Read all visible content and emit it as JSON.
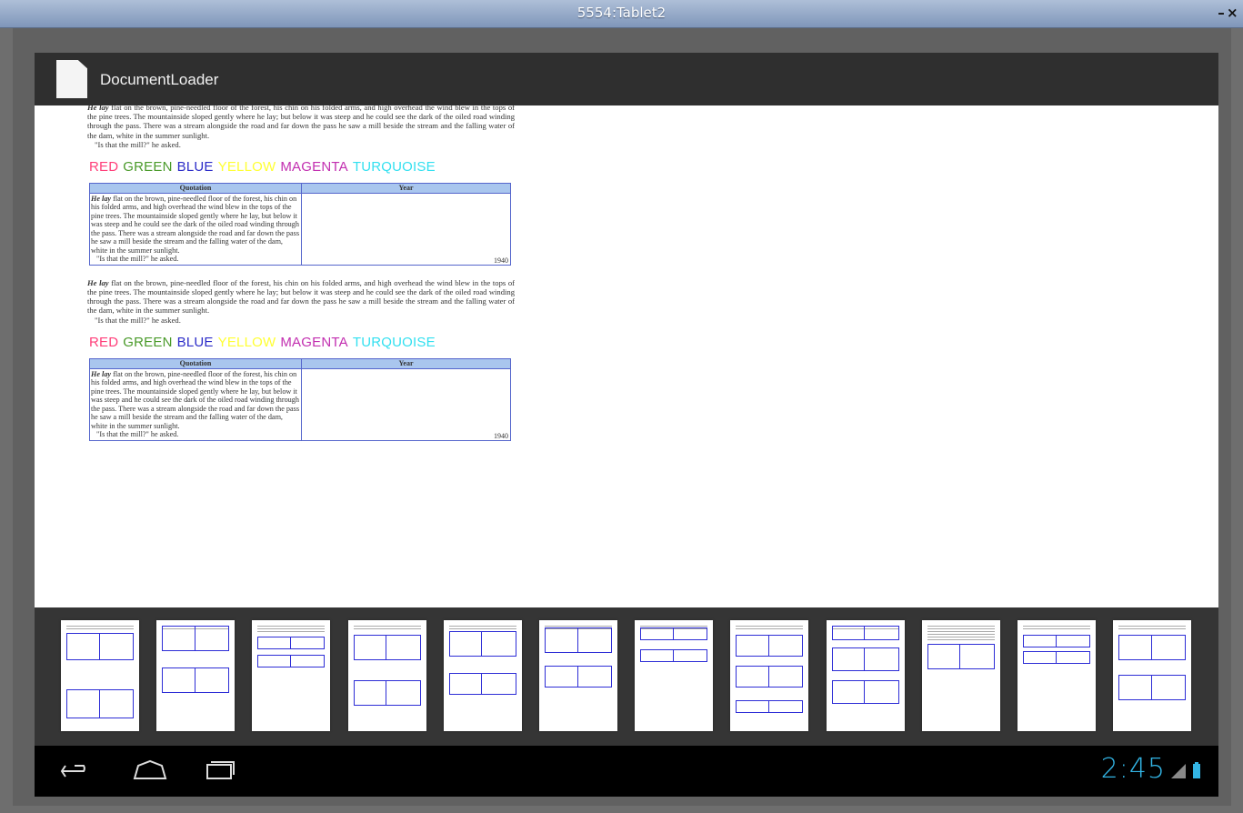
{
  "window": {
    "title": "5554:Tablet2",
    "minimize_label": "–",
    "close_label": "×"
  },
  "app": {
    "title": "DocumentLoader"
  },
  "document": {
    "paragraph_lead": "He lay",
    "paragraph_text": "flat on the brown, pine-needled floor of the forest, his chin on his folded arms, and high overhead the wind blew in the tops of the pine trees. The mountainside sloped gently where he lay; but below it was steep and he could see the dark of the oiled road winding through the pass. There was a stream alongside the road and far down the pass he saw a mill beside the stream and the falling water of the dam, white in the summer sunlight.",
    "quote_line": "\"Is that the mill?\" he asked.",
    "color_words": [
      {
        "text": "RED",
        "color": "#ff3f7a"
      },
      {
        "text": "GREEN",
        "color": "#4a9a2a"
      },
      {
        "text": "BLUE",
        "color": "#2c2cc8"
      },
      {
        "text": "YELLOW",
        "color": "#ffff33"
      },
      {
        "text": "MAGENTA",
        "color": "#c22fb0"
      },
      {
        "text": "TURQUOISE",
        "color": "#33e0f0"
      }
    ],
    "table": {
      "headers": [
        "Quotation",
        "Year"
      ],
      "cell_lead": "He lay",
      "cell_text": "flat on the brown, pine-needled floor of the forest, his chin on his folded arms, and high overhead the wind blew in the tops of the pine trees. The mountainside sloped gently where he lay, but below it was steep and he could see the dark of the oiled road winding through the pass. There was a stream alongside the road and far down the pass he saw a mill beside the stream and the falling water of the dam, white in the summer sunlight.",
      "cell_quote": "\"Is that the mill?\" he asked.",
      "year": "1940"
    }
  },
  "thumbnails": {
    "count": 12
  },
  "status_bar": {
    "time": "2:45"
  }
}
